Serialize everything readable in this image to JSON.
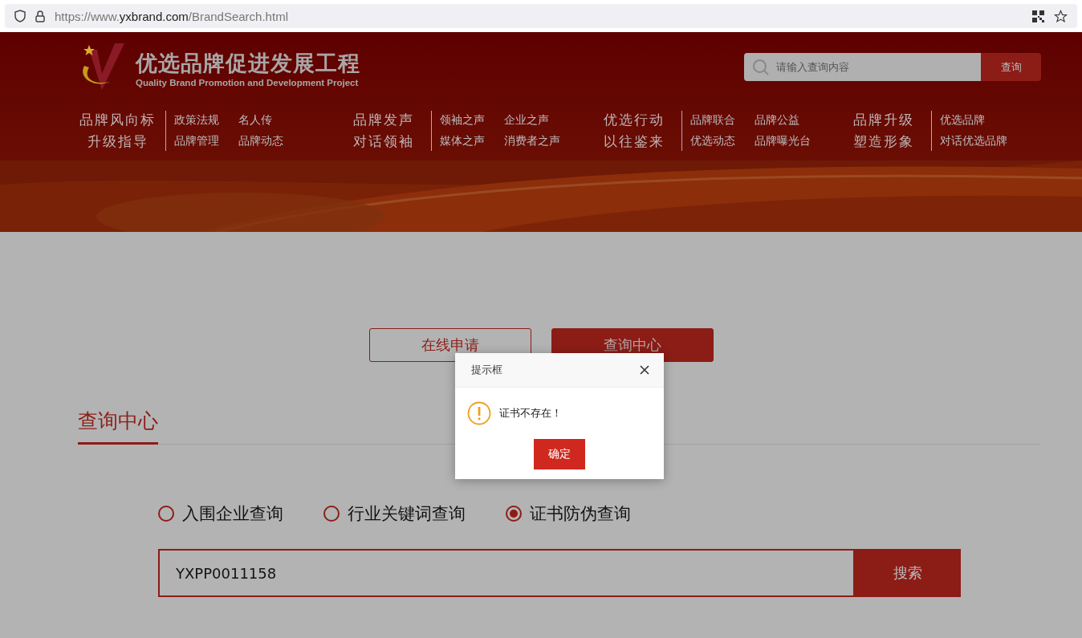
{
  "browser": {
    "url_prefix": "https://www.",
    "url_domain": "yxbrand.com",
    "url_path": "/BrandSearch.html"
  },
  "header": {
    "title": "优选品牌促进发展工程",
    "subtitle": "Quality Brand Promotion and Development Project",
    "search": {
      "placeholder": "请输入查询内容",
      "button": "查询"
    }
  },
  "nav": [
    {
      "headings": [
        "品牌风向标",
        "升级指导"
      ],
      "links": [
        "政策法规",
        "名人传",
        "品牌管理",
        "品牌动态"
      ]
    },
    {
      "headings": [
        "品牌发声",
        "对话领袖"
      ],
      "links": [
        "领袖之声",
        "企业之声",
        "媒体之声",
        "消费者之声"
      ]
    },
    {
      "headings": [
        "优选行动",
        "以往鉴来"
      ],
      "links": [
        "品牌联合",
        "品牌公益",
        "优选动态",
        "品牌曝光台"
      ]
    },
    {
      "headings": [
        "品牌升级",
        "塑造形象"
      ],
      "links": [
        "优选品牌",
        "对话优选品牌"
      ]
    }
  ],
  "top_buttons": [
    {
      "label": "在线申请",
      "selected": false
    },
    {
      "label": "查询中心",
      "selected": true
    }
  ],
  "section_title": "查询中心",
  "query_types": [
    {
      "label": "入围企业查询",
      "selected": false
    },
    {
      "label": "行业关键词查询",
      "selected": false
    },
    {
      "label": "证书防伪查询",
      "selected": true
    }
  ],
  "query": {
    "value": "YXPP0011158",
    "button": "搜索"
  },
  "dialog": {
    "title": "提示框",
    "message": "证书不存在！",
    "ok": "确定"
  }
}
